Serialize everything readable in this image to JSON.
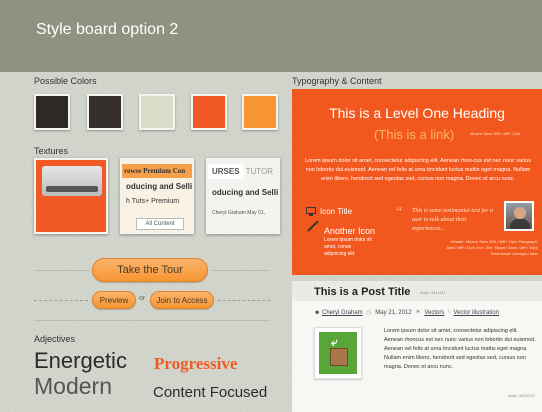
{
  "header": {
    "title": "Style board option 2"
  },
  "colors": {
    "label": "Possible Colors",
    "swatches": [
      {
        "name": "charcoal",
        "hex": "#2d2a26"
      },
      {
        "name": "dark-brown",
        "hex": "#342f2a"
      },
      {
        "name": "sage",
        "hex": "#d9dcc6"
      },
      {
        "name": "orange-red",
        "hex": "#f15a24"
      },
      {
        "name": "orange",
        "hex": "#f79633"
      }
    ]
  },
  "textures": {
    "label": "Textures",
    "tex2_band": "rowse Premium Con",
    "tex2_line1": "oducing and Selling",
    "tex2_line2": "h Tuts+ Premium",
    "tex2_button": "All Content",
    "tex3_tab1": "URSES",
    "tex3_tab2": "TUTOR",
    "tex3_line": "oducing and Sellin",
    "tex3_meta": "Cheryl Graham    May 01,"
  },
  "buttons": {
    "tour": "Take the Tour",
    "preview": "Preview",
    "or": "or",
    "join": "Join to Access"
  },
  "adjectives": {
    "label": "Adjectives",
    "items": [
      "Energetic",
      "Progressive",
      "Modern",
      "Content Focused"
    ]
  },
  "typography": {
    "label": "Typography & Content",
    "heading": "This is a Level One Heading",
    "link": "(This is a link)",
    "link_note": "Museo Sans 500 / #fff / 32pt",
    "lorem": "Lorem ipsum dolor sit amet, consectetur adipiscing elit. Aenean rhon-cus est nec nunc varius non lobortis dui euismod. Aenean vel felis at urna tincidunt luctus mattis eget magna. Nullam enim libero, hendrerit sed egestas sed, cursus non magna. Donec et arcu nunc.",
    "icon_title": "Icon Title",
    "another_icon": "Another Icon",
    "small_text": "Lorem ipsum dolor sit amet, conse adipiscing elit.",
    "testimonial": "This is some testimonial text for a user to talk about their experiences...",
    "specs": "Header: Museo Sans 500 / #fff / 19pt; Paragraph: Arial / #fff / 11pt; Icon Title: Museo Sans / #fff / 16pt; Testimonial: Georgia / italic"
  },
  "post": {
    "title": "This is  a Post Title",
    "title_note": "Arial / #111111",
    "author": "Cheryl Graham",
    "date": "May 21, 2012",
    "tag1": "Vectors",
    "tag2": "Vector illustration",
    "body": "Lorem ipsum dolor sit amet, consectetur adipiscing elit. Aenean rhoncus est nec nunc varius non lobortis dui euismod. Aenean vel felis at urna tincidunt luctus mattis eget magna. Nullam enim libero, hendrerit sed egestas sed, cursus non magna. Donec et arcu nunc.",
    "body_note": "Arial / #222222"
  }
}
